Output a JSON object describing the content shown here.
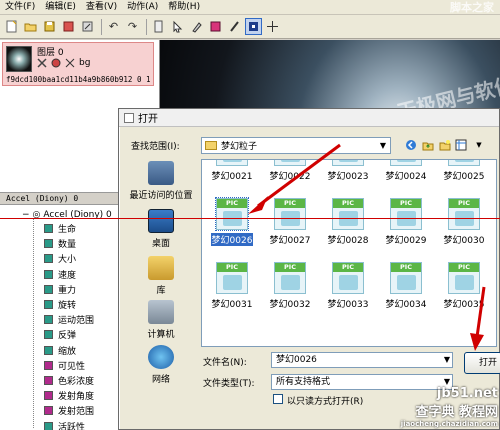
{
  "menubar": {
    "items": [
      "文件(F)",
      "编辑(E)",
      "查看(V)",
      "动作(A)",
      "帮助(H)"
    ],
    "site_logo": "脚本之家"
  },
  "layer_panel": {
    "layer_name": "图层 0",
    "layer_id": "f9dcd100baa1cd11b4a9b860b912  0 1",
    "small_label": "bg"
  },
  "canvas": {
    "watermark": "天极网与软件园"
  },
  "emitter_panel": {
    "header": "Accel (Diony) 0",
    "root": "Accel (Diony) 0",
    "properties": [
      {
        "label": "生命",
        "color": "#2a9a88"
      },
      {
        "label": "数量",
        "color": "#2a9a88"
      },
      {
        "label": "大小",
        "color": "#2a9a88"
      },
      {
        "label": "速度",
        "color": "#2a9a88"
      },
      {
        "label": "重力",
        "color": "#2a9a88"
      },
      {
        "label": "旋转",
        "color": "#2a9a88"
      },
      {
        "label": "运动范围",
        "color": "#2a9a88"
      },
      {
        "label": "反弹",
        "color": "#2a9a88"
      },
      {
        "label": "缩放",
        "color": "#2a9a88"
      },
      {
        "label": "可见性",
        "color": "#b02a8c"
      },
      {
        "label": "色彩浓度",
        "color": "#b02a8c"
      },
      {
        "label": "发射角度",
        "color": "#b02a8c"
      },
      {
        "label": "发射范围",
        "color": "#b02a8c"
      },
      {
        "label": "活跃性",
        "color": "#2a9a88"
      }
    ]
  },
  "dialog": {
    "title": "打开",
    "look_in_label": "查找范围(I):",
    "look_in_value": "梦幻粒子",
    "places": [
      "最近访问的位置",
      "桌面",
      "库",
      "计算机",
      "网络"
    ],
    "files": [
      {
        "name": "梦幻0021",
        "selected": false
      },
      {
        "name": "梦幻0022",
        "selected": false
      },
      {
        "name": "梦幻0023",
        "selected": false
      },
      {
        "name": "梦幻0024",
        "selected": false
      },
      {
        "name": "梦幻0025",
        "selected": false
      },
      {
        "name": "梦幻0026",
        "selected": true
      },
      {
        "name": "梦幻0027",
        "selected": false
      },
      {
        "name": "梦幻0028",
        "selected": false
      },
      {
        "name": "梦幻0029",
        "selected": false
      },
      {
        "name": "梦幻0030",
        "selected": false
      },
      {
        "name": "梦幻0031",
        "selected": false
      },
      {
        "name": "梦幻0032",
        "selected": false
      },
      {
        "name": "梦幻0033",
        "selected": false
      },
      {
        "name": "梦幻0034",
        "selected": false
      },
      {
        "name": "梦幻0035",
        "selected": false
      }
    ],
    "file_icon_badge": "PIC",
    "filename_label": "文件名(N):",
    "filename_value": "梦幻0026",
    "filetype_label": "文件类型(T):",
    "filetype_value": "所有支持格式",
    "readonly_label": "以只读方式打开(R)",
    "open_button": "打开"
  },
  "footer_watermark": {
    "line1": "查字典 教程网",
    "line2": "jiaocheng.chazidian.com",
    "site": "jb51.net"
  },
  "colors": {
    "selection": "#316ac5",
    "annotation_red": "#d00000"
  }
}
